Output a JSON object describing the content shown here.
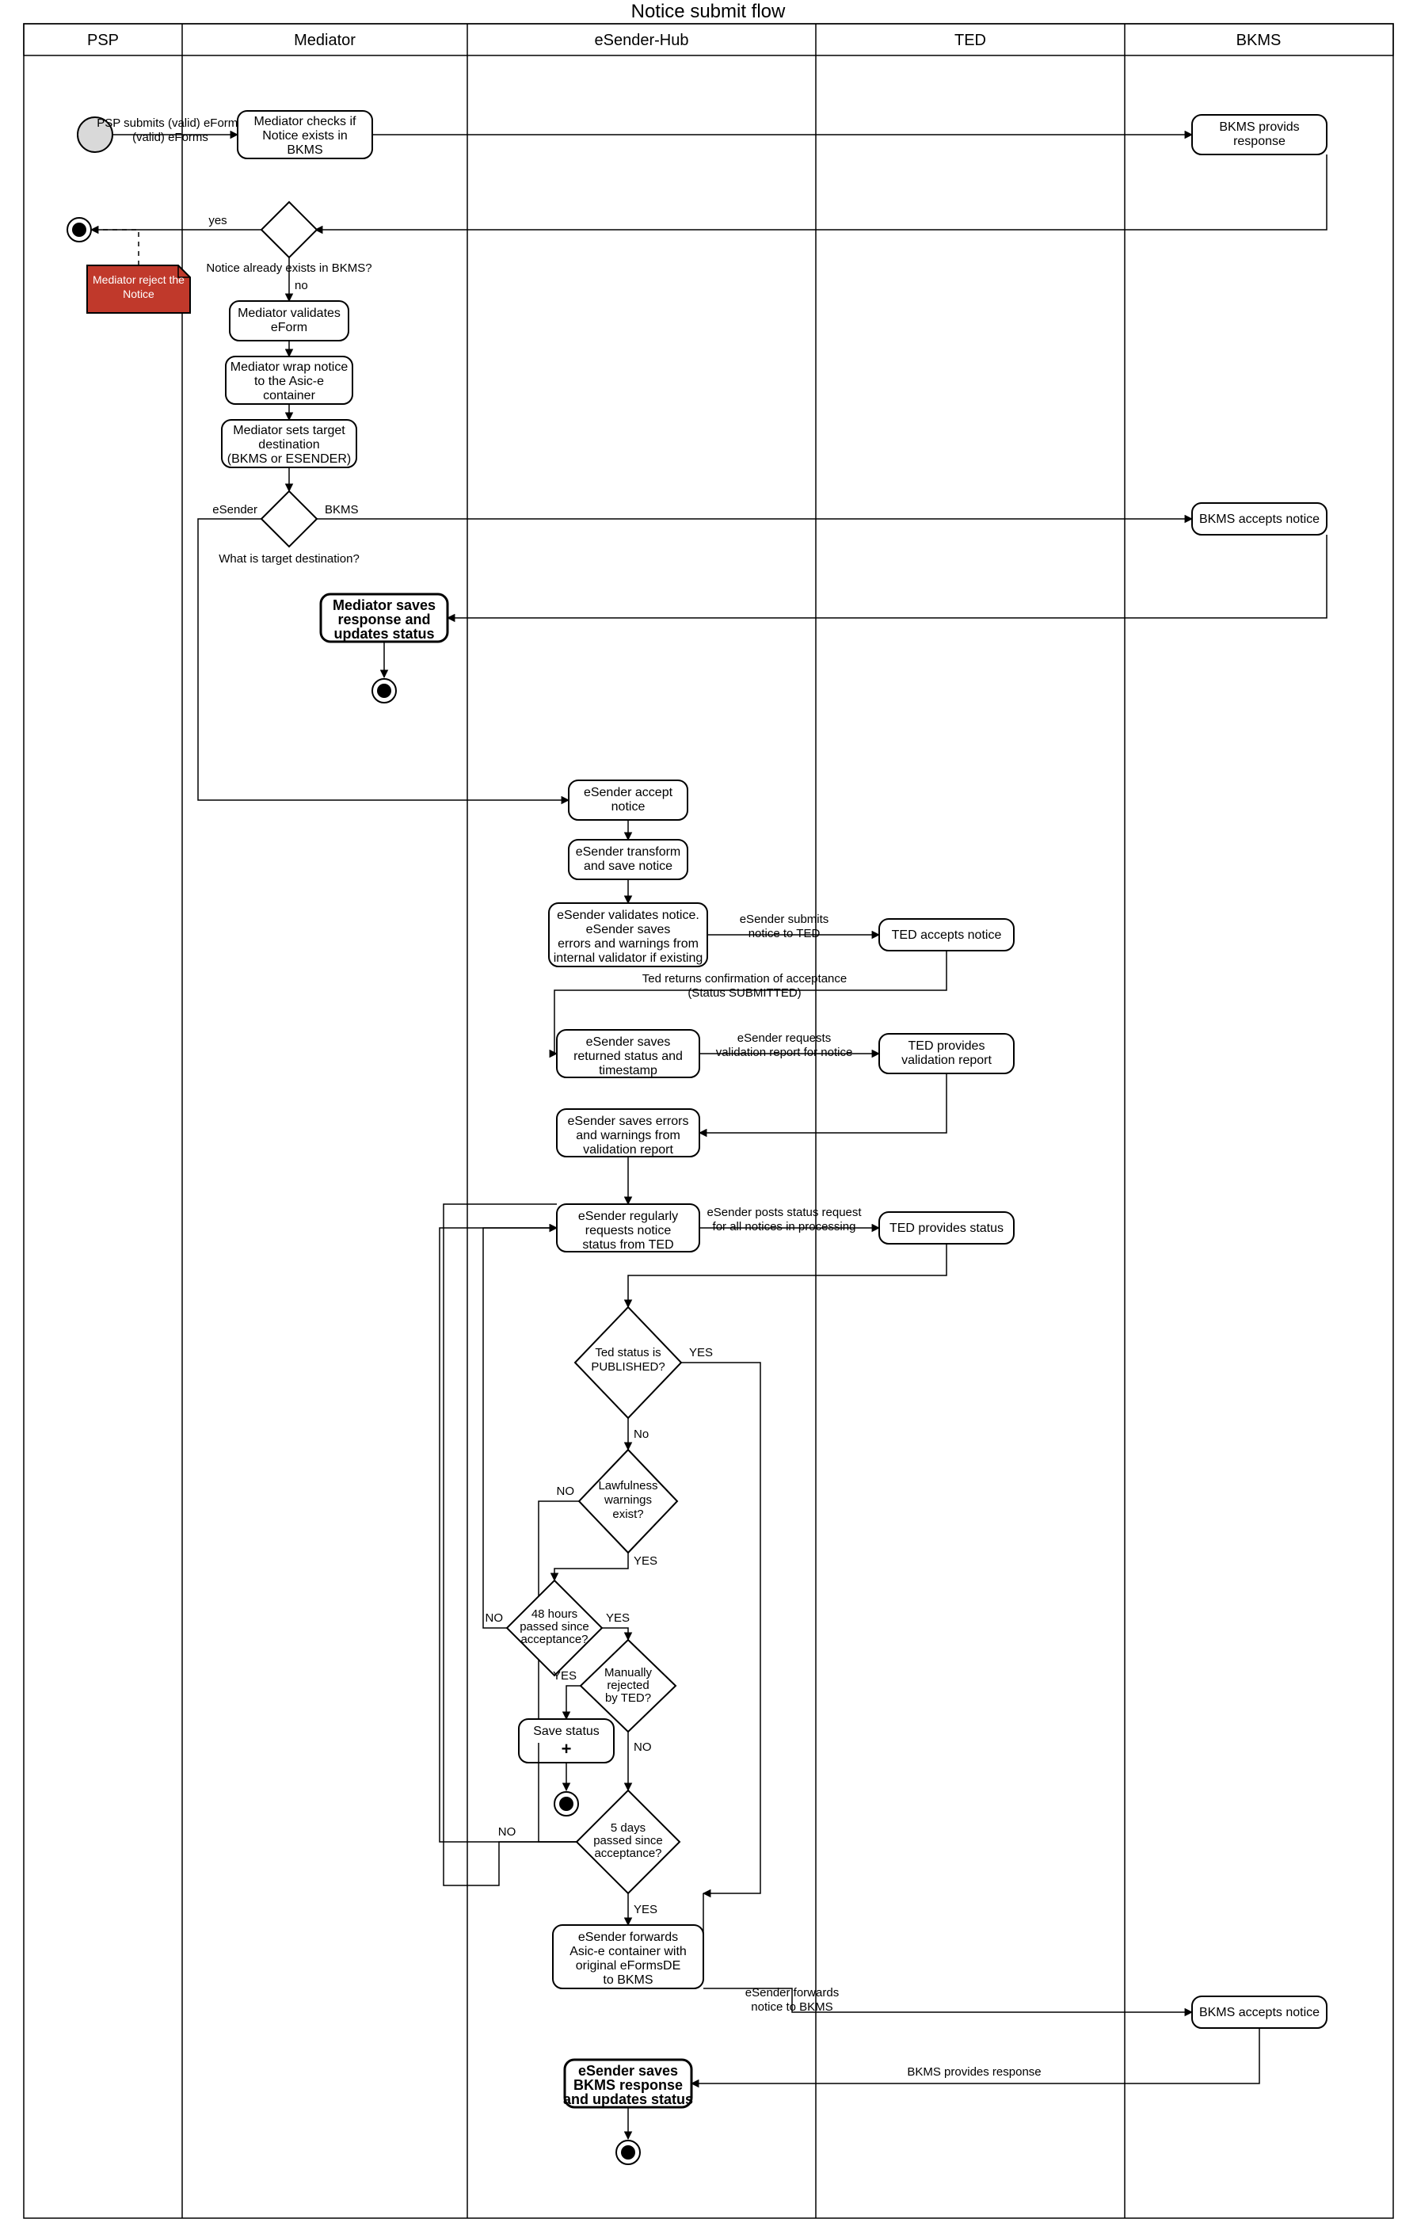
{
  "title": "Notice submit flow",
  "lanes": {
    "psp": "PSP",
    "mediator": "Mediator",
    "esender": "eSender-Hub",
    "ted": "TED",
    "bkms": "BKMS"
  },
  "psp_submits": "PSP submits\n(valid) eForms",
  "mediator_checks": "Mediator checks if\nNotice exists in\nBKMS",
  "bkms_provids": "BKMS provids\nresponse",
  "notice_exists_q": "Notice already exists in BKMS?",
  "yes": "yes",
  "no": "no",
  "reject_note": "Mediator reject the\nNotice",
  "mediator_validates": "Mediator validates\neForm",
  "mediator_wrap": "Mediator wrap notice\nto the Asic-e\ncontainer",
  "mediator_target": "Mediator sets target\ndestination\n(BKMS or ESENDER)",
  "target_q": "What is target destination?",
  "esender_lbl": "eSender",
  "bkms_lbl": "BKMS",
  "bkms_accepts": "BKMS accepts notice",
  "mediator_saves_bold": "Mediator saves\nresponse and\nupdates status",
  "es_accept": "eSender accept\nnotice",
  "es_transform": "eSender transform\nand save notice",
  "es_validates": "eSender validates notice.\neSender saves\nerrors and warnings from\ninternal validator if existing",
  "es_submits_ted": "eSender submits\nnotice to TED",
  "ted_accepts": "TED accepts notice",
  "ted_confirm": "Ted returns confirmation of acceptance\n(Status SUBMITTED)",
  "es_saves_ts": "eSender saves\nreturned status and\ntimestamp",
  "es_req_report": "eSender requests\nvalidation report for notice",
  "ted_report": "TED provides\nvalidation report",
  "es_saves_errors": "eSender saves errors\nand warnings from\nvalidation report",
  "es_regular": "eSender regularly\nrequests notice\nstatus from TED",
  "es_posts_status": "eSender posts status request\nfor all notices in processing",
  "ted_status": "TED provides status",
  "q_published": "Ted status is\nPUBLISHED?",
  "YES": "YES",
  "No": "No",
  "NO": "NO",
  "q_lawfulness": "Lawfulness\nwarnings\nexist?",
  "q_48h": "48 hours\npassed since\nacceptance?",
  "q_manual": "Manually\nrejected\nby TED?",
  "save_status": "Save status",
  "q_5days": "5 days\npassed since\nacceptance?",
  "es_forwards_bkms": "eSender forwards\nAsic-e container with\noriginal eFormsDE\nto BKMS",
  "es_forwards_lbl": "eSender forwards\nnotice to BKMS",
  "bkms_accepts2": "BKMS accepts notice",
  "bkms_provides_resp": "BKMS provides response",
  "es_saves_bkms": "eSender saves\nBKMS response\nand updates status"
}
